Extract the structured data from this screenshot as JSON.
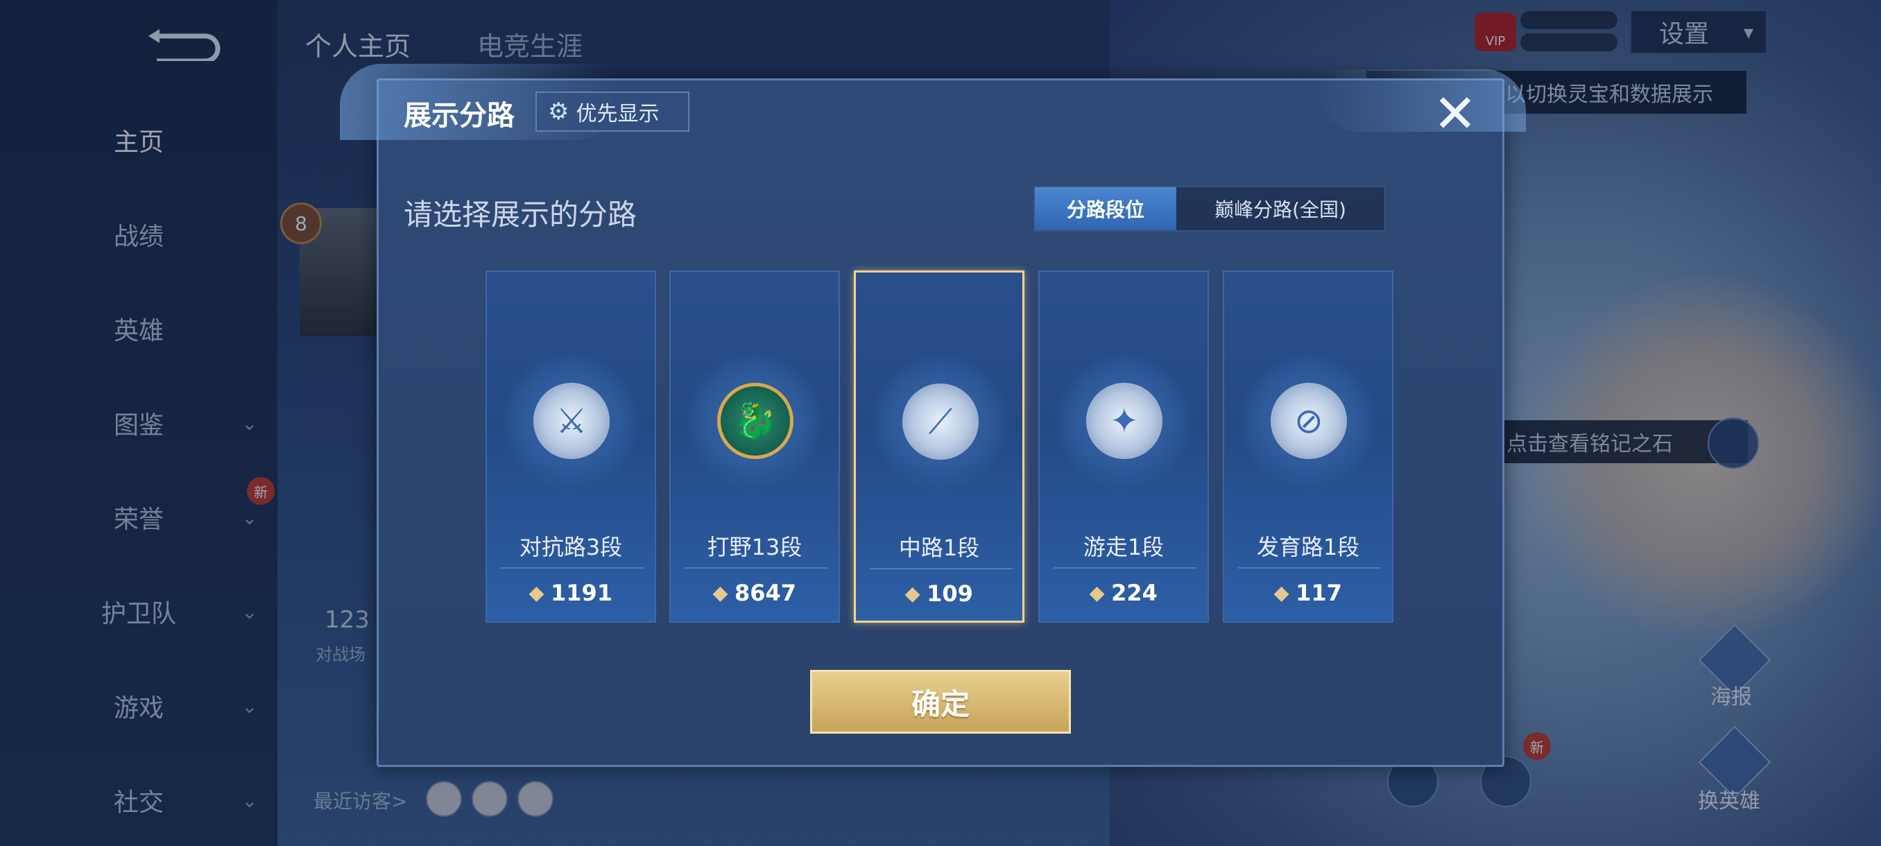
{
  "top_tabs": [
    "个人主页",
    "电竞生涯"
  ],
  "sidebar": {
    "items": [
      {
        "label": "主页",
        "has_dropdown": false
      },
      {
        "label": "战绩",
        "has_dropdown": false
      },
      {
        "label": "英雄",
        "has_dropdown": false
      },
      {
        "label": "图鉴",
        "has_dropdown": true
      },
      {
        "label": "荣誉",
        "has_dropdown": true
      },
      {
        "label": "护卫队",
        "has_dropdown": true
      },
      {
        "label": "游戏",
        "has_dropdown": true
      },
      {
        "label": "社交",
        "has_dropdown": true
      }
    ],
    "new_badge": "新"
  },
  "profile": {
    "rank_level": "8",
    "count_partial": "123",
    "sub_partial": "对战场",
    "visitors_label": "最近访客>"
  },
  "top_right": {
    "vip": "VIP",
    "settings_label": "设置",
    "tip_switch": "以切换灵宝和数据展示",
    "tip_stone": "点击查看铭记之石",
    "poster_label": "海报",
    "swap_hero_label": "换英雄",
    "new_badge": "新"
  },
  "modal": {
    "title": "展示分路",
    "priority_button": "优先显示",
    "prompt": "请选择展示的分路",
    "segment": {
      "options": [
        "分路段位",
        "巅峰分路(全国)"
      ],
      "selected": "分路段位"
    },
    "cards": [
      {
        "name": "对抗路3段",
        "points": "1191",
        "icon": "clash-lane-icon",
        "selected": false
      },
      {
        "name": "打野13段",
        "points": "8647",
        "icon": "jungle-icon",
        "selected": false
      },
      {
        "name": "中路1段",
        "points": "109",
        "icon": "mid-lane-icon",
        "selected": true
      },
      {
        "name": "游走1段",
        "points": "224",
        "icon": "roam-icon",
        "selected": false
      },
      {
        "name": "发育路1段",
        "points": "117",
        "icon": "farm-lane-icon",
        "selected": false
      }
    ],
    "confirm_label": "确定"
  },
  "colors": {
    "accent_gold": "#e0c07a",
    "selected_border": "#f4d28a",
    "segment_active": "#3d77c3"
  }
}
